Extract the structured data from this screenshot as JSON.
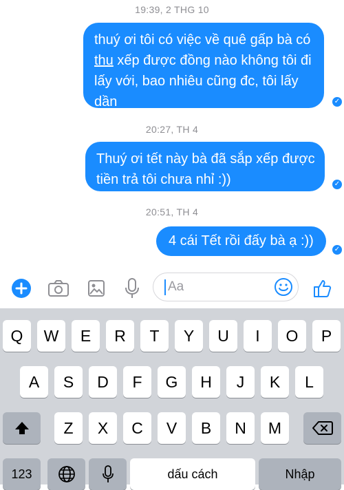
{
  "conversation": {
    "messages": [
      {
        "timestamp": "19:39, 2 THG 10",
        "text_before": "thuý ơi tôi có việc về quê gấp bà có ",
        "underlined": "thu",
        "text_after": " xếp được đồng nào không tôi đi lấy với, bao nhiêu cũng đc, tôi lấy dần",
        "status": "seen"
      },
      {
        "timestamp": "20:27, TH 4",
        "text": "Thuý ơi tết này bà đã sắp xếp được tiền trả tôi chưa nhỉ :))",
        "status": "seen"
      },
      {
        "timestamp": "20:51, TH 4",
        "text": "4 cái Tết rồi đấy bà ạ :))",
        "status": "seen"
      }
    ]
  },
  "composer": {
    "placeholder": "Aa",
    "icons": [
      "plus-icon",
      "camera-icon",
      "gallery-icon",
      "microphone-icon",
      "emoji-icon",
      "like-icon"
    ],
    "accent_color": "#1a8cff"
  },
  "keyboard": {
    "row1": [
      "Q",
      "W",
      "E",
      "R",
      "T",
      "Y",
      "U",
      "I",
      "O",
      "P"
    ],
    "row2": [
      "A",
      "S",
      "D",
      "F",
      "G",
      "H",
      "J",
      "K",
      "L"
    ],
    "row3": [
      "Z",
      "X",
      "C",
      "V",
      "B",
      "N",
      "M"
    ],
    "numbers_label": "123",
    "space_label": "dấu cách",
    "return_label": "Nhập",
    "icons": [
      "shift-icon",
      "delete-icon",
      "globe-icon",
      "dictation-icon"
    ]
  }
}
